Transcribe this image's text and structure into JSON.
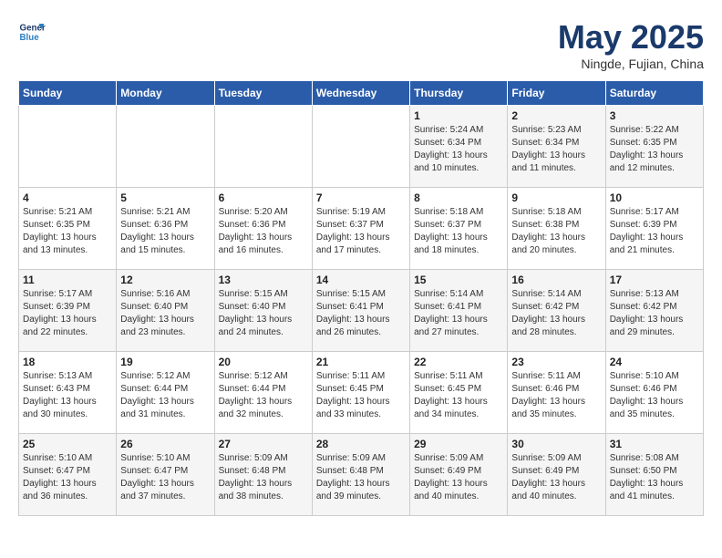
{
  "header": {
    "logo_line1": "General",
    "logo_line2": "Blue",
    "month": "May 2025",
    "location": "Ningde, Fujian, China"
  },
  "weekdays": [
    "Sunday",
    "Monday",
    "Tuesday",
    "Wednesday",
    "Thursday",
    "Friday",
    "Saturday"
  ],
  "weeks": [
    [
      {
        "day": "",
        "info": ""
      },
      {
        "day": "",
        "info": ""
      },
      {
        "day": "",
        "info": ""
      },
      {
        "day": "",
        "info": ""
      },
      {
        "day": "1",
        "info": "Sunrise: 5:24 AM\nSunset: 6:34 PM\nDaylight: 13 hours\nand 10 minutes."
      },
      {
        "day": "2",
        "info": "Sunrise: 5:23 AM\nSunset: 6:34 PM\nDaylight: 13 hours\nand 11 minutes."
      },
      {
        "day": "3",
        "info": "Sunrise: 5:22 AM\nSunset: 6:35 PM\nDaylight: 13 hours\nand 12 minutes."
      }
    ],
    [
      {
        "day": "4",
        "info": "Sunrise: 5:21 AM\nSunset: 6:35 PM\nDaylight: 13 hours\nand 13 minutes."
      },
      {
        "day": "5",
        "info": "Sunrise: 5:21 AM\nSunset: 6:36 PM\nDaylight: 13 hours\nand 15 minutes."
      },
      {
        "day": "6",
        "info": "Sunrise: 5:20 AM\nSunset: 6:36 PM\nDaylight: 13 hours\nand 16 minutes."
      },
      {
        "day": "7",
        "info": "Sunrise: 5:19 AM\nSunset: 6:37 PM\nDaylight: 13 hours\nand 17 minutes."
      },
      {
        "day": "8",
        "info": "Sunrise: 5:18 AM\nSunset: 6:37 PM\nDaylight: 13 hours\nand 18 minutes."
      },
      {
        "day": "9",
        "info": "Sunrise: 5:18 AM\nSunset: 6:38 PM\nDaylight: 13 hours\nand 20 minutes."
      },
      {
        "day": "10",
        "info": "Sunrise: 5:17 AM\nSunset: 6:39 PM\nDaylight: 13 hours\nand 21 minutes."
      }
    ],
    [
      {
        "day": "11",
        "info": "Sunrise: 5:17 AM\nSunset: 6:39 PM\nDaylight: 13 hours\nand 22 minutes."
      },
      {
        "day": "12",
        "info": "Sunrise: 5:16 AM\nSunset: 6:40 PM\nDaylight: 13 hours\nand 23 minutes."
      },
      {
        "day": "13",
        "info": "Sunrise: 5:15 AM\nSunset: 6:40 PM\nDaylight: 13 hours\nand 24 minutes."
      },
      {
        "day": "14",
        "info": "Sunrise: 5:15 AM\nSunset: 6:41 PM\nDaylight: 13 hours\nand 26 minutes."
      },
      {
        "day": "15",
        "info": "Sunrise: 5:14 AM\nSunset: 6:41 PM\nDaylight: 13 hours\nand 27 minutes."
      },
      {
        "day": "16",
        "info": "Sunrise: 5:14 AM\nSunset: 6:42 PM\nDaylight: 13 hours\nand 28 minutes."
      },
      {
        "day": "17",
        "info": "Sunrise: 5:13 AM\nSunset: 6:42 PM\nDaylight: 13 hours\nand 29 minutes."
      }
    ],
    [
      {
        "day": "18",
        "info": "Sunrise: 5:13 AM\nSunset: 6:43 PM\nDaylight: 13 hours\nand 30 minutes."
      },
      {
        "day": "19",
        "info": "Sunrise: 5:12 AM\nSunset: 6:44 PM\nDaylight: 13 hours\nand 31 minutes."
      },
      {
        "day": "20",
        "info": "Sunrise: 5:12 AM\nSunset: 6:44 PM\nDaylight: 13 hours\nand 32 minutes."
      },
      {
        "day": "21",
        "info": "Sunrise: 5:11 AM\nSunset: 6:45 PM\nDaylight: 13 hours\nand 33 minutes."
      },
      {
        "day": "22",
        "info": "Sunrise: 5:11 AM\nSunset: 6:45 PM\nDaylight: 13 hours\nand 34 minutes."
      },
      {
        "day": "23",
        "info": "Sunrise: 5:11 AM\nSunset: 6:46 PM\nDaylight: 13 hours\nand 35 minutes."
      },
      {
        "day": "24",
        "info": "Sunrise: 5:10 AM\nSunset: 6:46 PM\nDaylight: 13 hours\nand 35 minutes."
      }
    ],
    [
      {
        "day": "25",
        "info": "Sunrise: 5:10 AM\nSunset: 6:47 PM\nDaylight: 13 hours\nand 36 minutes."
      },
      {
        "day": "26",
        "info": "Sunrise: 5:10 AM\nSunset: 6:47 PM\nDaylight: 13 hours\nand 37 minutes."
      },
      {
        "day": "27",
        "info": "Sunrise: 5:09 AM\nSunset: 6:48 PM\nDaylight: 13 hours\nand 38 minutes."
      },
      {
        "day": "28",
        "info": "Sunrise: 5:09 AM\nSunset: 6:48 PM\nDaylight: 13 hours\nand 39 minutes."
      },
      {
        "day": "29",
        "info": "Sunrise: 5:09 AM\nSunset: 6:49 PM\nDaylight: 13 hours\nand 40 minutes."
      },
      {
        "day": "30",
        "info": "Sunrise: 5:09 AM\nSunset: 6:49 PM\nDaylight: 13 hours\nand 40 minutes."
      },
      {
        "day": "31",
        "info": "Sunrise: 5:08 AM\nSunset: 6:50 PM\nDaylight: 13 hours\nand 41 minutes."
      }
    ]
  ]
}
